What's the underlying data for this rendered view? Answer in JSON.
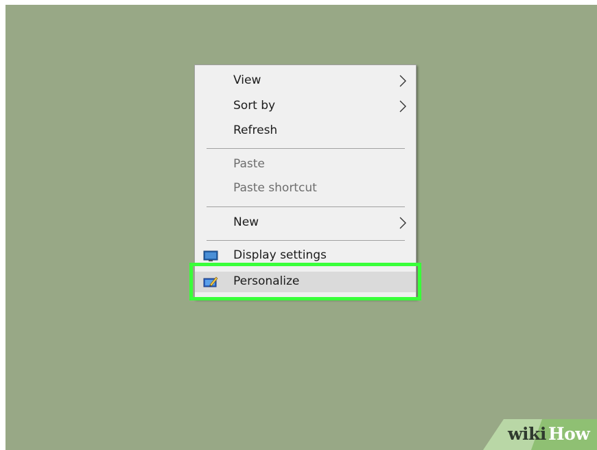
{
  "context_menu": {
    "items": [
      {
        "label": "View",
        "has_submenu": true,
        "enabled": true
      },
      {
        "label": "Sort by",
        "has_submenu": true,
        "enabled": true
      },
      {
        "label": "Refresh",
        "has_submenu": false,
        "enabled": true
      },
      {
        "label": "Paste",
        "has_submenu": false,
        "enabled": false
      },
      {
        "label": "Paste shortcut",
        "has_submenu": false,
        "enabled": false
      },
      {
        "label": "New",
        "has_submenu": true,
        "enabled": true
      },
      {
        "label": "Display settings",
        "icon": "display-icon",
        "enabled": true
      },
      {
        "label": "Personalize",
        "icon": "personalize-icon",
        "enabled": true,
        "highlighted": true
      }
    ]
  },
  "highlight_color": "#39ff3a",
  "desktop_color": "#98a886",
  "watermark": {
    "wiki": "wiki",
    "how": "How"
  }
}
